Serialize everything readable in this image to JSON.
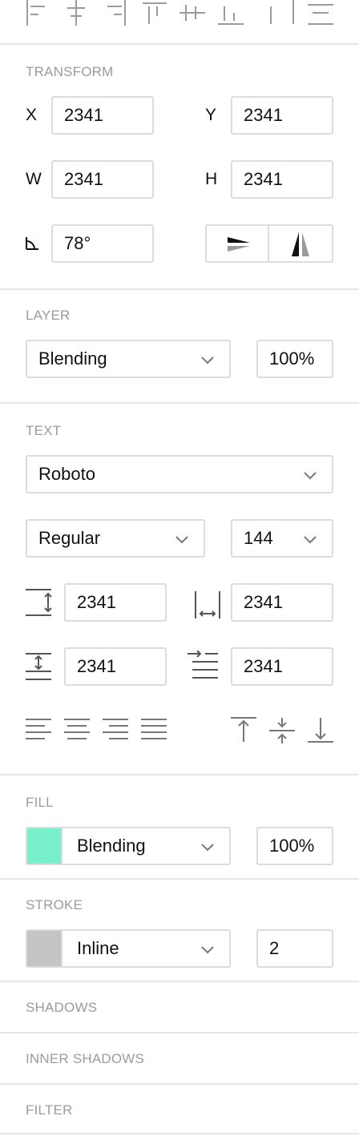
{
  "alignment_bar": {
    "icons": [
      "align-left-icon",
      "align-center-h-icon",
      "align-right-icon",
      "align-top-icon",
      "align-center-v-icon",
      "align-bottom-icon",
      "distribute-h-icon",
      "distribute-v-icon"
    ]
  },
  "transform": {
    "title": "TRANSFORM",
    "x_label": "X",
    "x_value": "2341",
    "y_label": "Y",
    "y_value": "2341",
    "w_label": "W",
    "w_value": "2341",
    "h_label": "H",
    "h_value": "2341",
    "rotation_value": "78°",
    "flip_icons": [
      "flip-horizontal-icon",
      "flip-vertical-icon"
    ]
  },
  "layer": {
    "title": "LAYER",
    "blending": "Blending",
    "opacity": "100%"
  },
  "text": {
    "title": "TEXT",
    "font_family": "Roboto",
    "font_weight": "Regular",
    "font_size": "144",
    "line_height": "2341",
    "letter_spacing": "2341",
    "paragraph_spacing": "2341",
    "indent": "2341",
    "align_icons": [
      "text-align-left-icon",
      "text-align-center-icon",
      "text-align-right-icon",
      "text-align-justify-icon"
    ],
    "valign_icons": [
      "text-valign-top-icon",
      "text-valign-middle-icon",
      "text-valign-bottom-icon"
    ]
  },
  "fill": {
    "title": "FILL",
    "color": "#77F0CB",
    "blending": "Blending",
    "opacity": "100%"
  },
  "stroke": {
    "title": "STROKE",
    "color": "#C4C4C4",
    "position": "Inline",
    "width": "2"
  },
  "shadows": {
    "title": "SHADOWS"
  },
  "inner_shadows": {
    "title": "INNER SHADOWS"
  },
  "filter": {
    "title": "FILTER"
  }
}
